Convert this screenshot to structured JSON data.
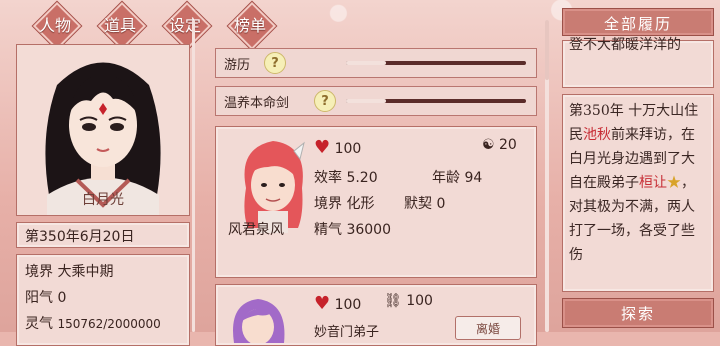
{
  "tabs": [
    "人物",
    "道具",
    "设定",
    "榜单"
  ],
  "character": {
    "name": "白月光",
    "date": "第350年6月20日",
    "realm_label": "境界",
    "realm_value": "大乘中期",
    "yang_label": "阳气",
    "yang_value": "0",
    "spirit_label": "灵气",
    "spirit_value": "150762/2000000"
  },
  "actions": [
    {
      "label": "游历",
      "help": "?",
      "progress": 0.22
    },
    {
      "label": "温养本命剑",
      "help": "?",
      "progress": 0.22
    }
  ],
  "encounter": {
    "hp": "100",
    "yinyang": "20",
    "efficiency_label": "效率",
    "efficiency_value": "5.20",
    "age_label": "年龄",
    "age_value": "94",
    "realm_label": "境界",
    "realm_value": "化形",
    "bond_label": "默契",
    "bond_value": "0",
    "name": "风君泉风",
    "essence_label": "精气",
    "essence_value": "36000"
  },
  "encounter2": {
    "hp": "100",
    "cuffs": "100",
    "name_partial": "妙音门弟子",
    "button": "离婚"
  },
  "history": {
    "header": "全部履历",
    "entry1": "登不大都暖洋洋的",
    "entry2_a": "第350年 十万大山住民",
    "entry2_b": "池秋",
    "entry2_c": "前来拜访，在白月光身边遇到了大自在殿弟子",
    "entry2_d": "桓让",
    "entry2_e": "★",
    "entry2_f": "，对其极为不满，两人打了一场，各受了些伤",
    "explore": "探索"
  },
  "colors": {
    "accent": "#c96f67",
    "panel": "#f2dad5",
    "highlight": "#c72d35"
  }
}
